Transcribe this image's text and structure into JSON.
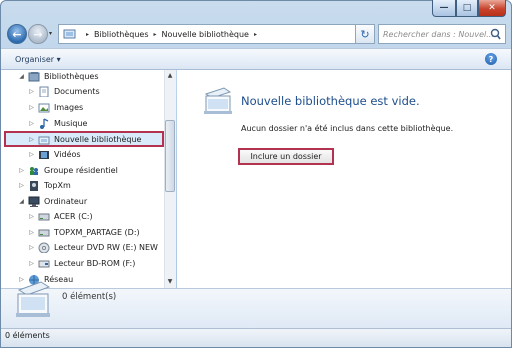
{
  "window": {
    "caption_buttons": {
      "minimize": "—",
      "maximize": "□",
      "close": "✕"
    }
  },
  "navigation": {
    "back_glyph": "←",
    "forward_glyph": "→",
    "dropdown_glyph": "▾",
    "breadcrumbs": [
      "Bibliothèques",
      "Nouvelle bibliothèque"
    ],
    "separator_glyph": "▸",
    "refresh_glyph": "↻",
    "search_placeholder": "Rechercher dans : Nouvel..."
  },
  "toolbar": {
    "organiser_label": "Organiser ▾",
    "help_glyph": "?"
  },
  "tree": {
    "items": [
      {
        "label": "Bibliothèques",
        "toggle": "◢",
        "icon": "libraries-icon"
      },
      {
        "label": "Documents",
        "toggle": "▷",
        "icon": "documents-icon"
      },
      {
        "label": "Images",
        "toggle": "▷",
        "icon": "images-icon"
      },
      {
        "label": "Musique",
        "toggle": "▷",
        "icon": "music-icon"
      },
      {
        "label": "Nouvelle bibliothèque",
        "toggle": "▷",
        "icon": "library-icon"
      },
      {
        "label": "Vidéos",
        "toggle": "▷",
        "icon": "videos-icon"
      },
      {
        "label": "Groupe résidentiel",
        "toggle": "▷",
        "icon": "homegroup-icon"
      },
      {
        "label": "TopXm",
        "toggle": "▷",
        "icon": "user-folder-icon"
      },
      {
        "label": "Ordinateur",
        "toggle": "◢",
        "icon": "computer-icon"
      },
      {
        "label": "ACER (C:)",
        "toggle": "▷",
        "icon": "hard-drive-icon"
      },
      {
        "label": "TOPXM_PARTAGE (D:)",
        "toggle": "▷",
        "icon": "hard-drive-icon"
      },
      {
        "label": "Lecteur DVD RW (E:) NEW",
        "toggle": "▷",
        "icon": "dvd-drive-icon"
      },
      {
        "label": "Lecteur BD-ROM (F:)",
        "toggle": "▷",
        "icon": "bd-drive-icon"
      },
      {
        "label": "Réseau",
        "toggle": "▷",
        "icon": "network-icon"
      }
    ],
    "selected_index": 4
  },
  "scrollbar": {
    "up_glyph": "▲",
    "down_glyph": "▼"
  },
  "content": {
    "title": "Nouvelle bibliothèque est vide.",
    "description": "Aucun dossier n'a été inclus dans cette bibliothèque.",
    "include_button": "Inclure un dossier"
  },
  "details": {
    "count": "0 élément(s)"
  },
  "status": {
    "text": "0 éléments"
  },
  "colors": {
    "accent": "#1e4e8c",
    "highlight_border": "#b2324f",
    "selection_fill": "#d9ebfb"
  }
}
